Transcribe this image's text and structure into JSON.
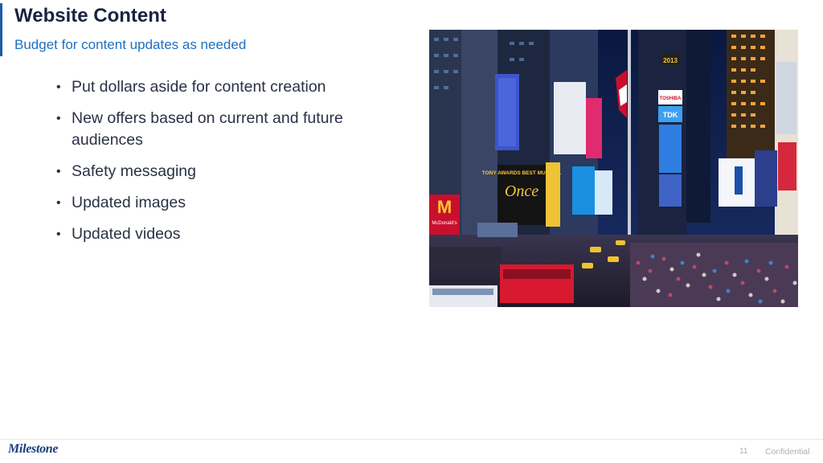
{
  "slide": {
    "title": "Website Content",
    "subtitle": "Budget for content updates as needed",
    "bullets": [
      "Put dollars aside for content creation",
      "New offers based on current and future audiences",
      "Safety messaging",
      "Updated images",
      "Updated videos"
    ],
    "bullet_symbol": "•"
  },
  "photo": {
    "signs": {
      "tony_awards": "TONY AWARDS BEST MUSICAL",
      "once": "Once",
      "mcdonalds": "McDonald's",
      "tdk": "TDK",
      "toshiba": "TOSHIBA",
      "year": "2013"
    }
  },
  "footer": {
    "logo_text": "Milestone",
    "page_number": "11",
    "confidential": "Confidential"
  },
  "colors": {
    "title": "#1c2340",
    "subtitle": "#1f6fc1",
    "accent_bar": "#1f5aa6",
    "body_text": "#2a3145",
    "footer_text": "#a9b0bb",
    "logo": "#1a3d7c"
  }
}
